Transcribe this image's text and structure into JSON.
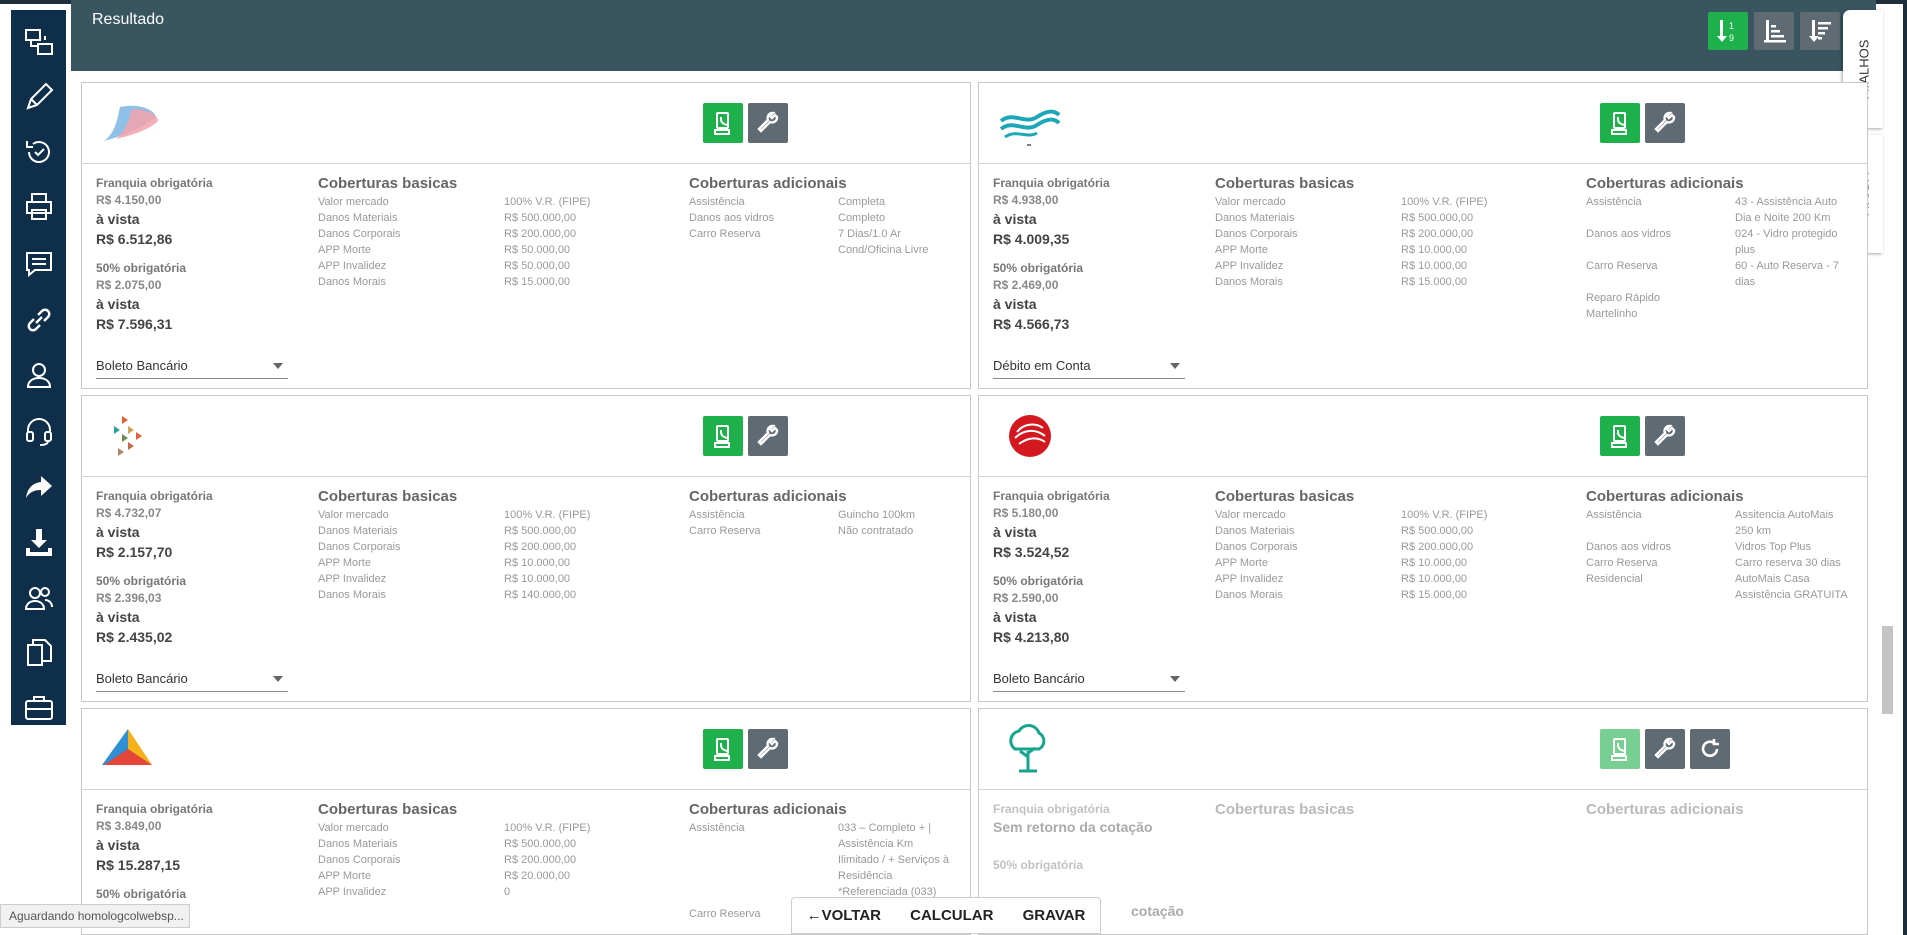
{
  "header": {
    "title": "Resultado"
  },
  "side_tabs": {
    "atalhos": "ATALHOS",
    "ajuda": "AJUDA"
  },
  "status": "Aguardando homologcolwebsp...",
  "actions": {
    "back": "VOLTAR",
    "calc": "CALCULAR",
    "save": "GRAVAR"
  },
  "labels": {
    "franquia": "Franquia obrigatória",
    "franquia50": "50% obrigatória",
    "avista": "à vista",
    "basicas": "Coberturas basicas",
    "adicionais": "Coberturas adicionais",
    "sem_retorno": "Sem retorno da cotação",
    "cotacao_partial": "cotação"
  },
  "basic_keys": [
    "Valor mercado",
    "Danos Materiais",
    "Danos Corporais",
    "APP Morte",
    "APP Invalidez",
    "Danos Morais"
  ],
  "cards": [
    {
      "franquia_val": "R$ 4.150,00",
      "avista1": "R$ 6.512,86",
      "franquia50_val": "R$ 2.075,00",
      "avista2": "R$ 7.596,31",
      "payment": "Boleto Bancário",
      "basic_vals": [
        "100% V.R. (FIPE)",
        "R$ 500.000,00",
        "R$ 200.000,00",
        "R$ 50.000,00",
        "R$ 50.000,00",
        "R$ 15.000,00"
      ],
      "additional": [
        [
          "Assistência",
          "Completa"
        ],
        [
          "Danos aos vidros",
          "Completo"
        ],
        [
          "Carro Reserva",
          "7 Dias/1.0 Ar"
        ],
        [
          "",
          "Cond/Oficina Livre"
        ]
      ]
    },
    {
      "franquia_val": "R$ 4.938,00",
      "avista1": "R$ 4.009,35",
      "franquia50_val": "R$ 2.469,00",
      "avista2": "R$ 4.566,73",
      "payment": "Débito em Conta",
      "basic_vals": [
        "100% V.R. (FIPE)",
        "R$ 500.000,00",
        "R$ 200.000,00",
        "R$ 10.000,00",
        "R$ 10.000,00",
        "R$ 15.000,00"
      ],
      "additional": [
        [
          "Assistência",
          "43 - Assistência Auto"
        ],
        [
          "",
          "Dia e Noite 200 Km"
        ],
        [
          "Danos aos vidros",
          "024 - Vidro protegido"
        ],
        [
          "",
          "plus"
        ],
        [
          "Carro Reserva",
          "60 - Auto Reserva - 7"
        ],
        [
          "",
          "dias"
        ],
        [
          "Reparo Rápido",
          ""
        ],
        [
          "Martelinho",
          ""
        ]
      ]
    },
    {
      "franquia_val": "R$ 4.732,07",
      "avista1": "R$ 2.157,70",
      "franquia50_val": "R$ 2.396,03",
      "avista2": "R$ 2.435,02",
      "payment": "Boleto Bancário",
      "basic_vals": [
        "100% V.R. (FIPE)",
        "R$ 500.000,00",
        "R$ 200.000,00",
        "R$ 10.000,00",
        "R$ 10.000,00",
        "R$ 140.000,00"
      ],
      "additional": [
        [
          "Assistência",
          "Guincho 100km"
        ],
        [
          "Carro Reserva",
          "Não contratado"
        ]
      ]
    },
    {
      "franquia_val": "R$ 5.180,00",
      "avista1": "R$ 3.524,52",
      "franquia50_val": "R$ 2.590,00",
      "avista2": "R$ 4.213,80",
      "payment": "Boleto Bancário",
      "basic_vals": [
        "100% V.R. (FIPE)",
        "R$ 500.000,00",
        "R$ 200.000,00",
        "R$ 10.000,00",
        "R$ 10.000,00",
        "R$ 15.000,00"
      ],
      "additional": [
        [
          "Assistência",
          "Assitencia AutoMais"
        ],
        [
          "",
          "250 km"
        ],
        [
          "Danos aos vidros",
          "Vidros Top Plus"
        ],
        [
          "Carro Reserva",
          "Carro reserva 30 dias"
        ],
        [
          "Residencial",
          "AutoMais Casa"
        ],
        [
          "",
          "Assistência GRATUITA"
        ]
      ]
    },
    {
      "franquia_val": "R$ 3.849,00",
      "avista1": "R$ 15.287,15",
      "basic_vals": [
        "100% V.R. (FIPE)",
        "R$ 500.000,00",
        "R$ 200.000,00",
        "R$ 20.000,00",
        "0"
      ],
      "additional": [
        [
          "Assistência",
          "033 – Completo + |"
        ],
        [
          "",
          "Assistência Km"
        ],
        [
          "",
          "Ilimitado / + Serviços à"
        ],
        [
          "",
          "Residência"
        ],
        [
          "",
          "*Referenciada (033)"
        ],
        [
          "Carro Reserva",
          ""
        ]
      ]
    }
  ]
}
